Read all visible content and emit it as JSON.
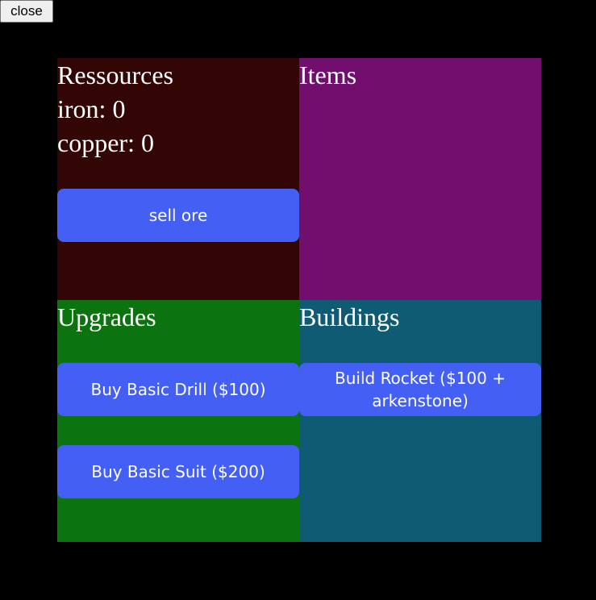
{
  "close_label": "close",
  "colors": {
    "background": "#000000",
    "resources_panel": "#330606",
    "items_panel": "#720f6e",
    "upgrades_panel": "#0c740e",
    "buildings_panel": "#105b74",
    "button": "#435ff4"
  },
  "resources": {
    "title": "Ressources",
    "iron_label": "iron: 0",
    "copper_label": "copper: 0",
    "sell_button": "sell ore"
  },
  "items": {
    "title": "Items"
  },
  "upgrades": {
    "title": "Upgrades",
    "buttons": [
      "Buy Basic Drill ($100)",
      "Buy Basic Suit ($200)"
    ]
  },
  "buildings": {
    "title": "Buildings",
    "buttons": [
      "Build Rocket ($100 + arkenstone)"
    ]
  }
}
